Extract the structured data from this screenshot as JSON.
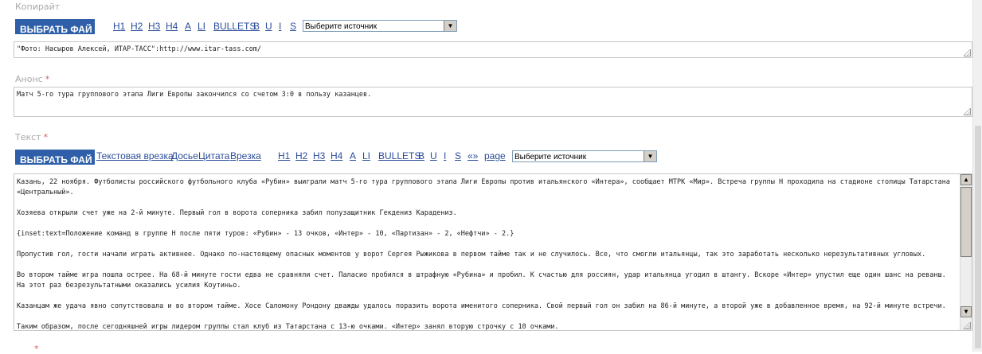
{
  "copyright": {
    "label": "Копирайт",
    "upload_label": "ВЫБРАТЬ ФАЙ",
    "toolbar": [
      "H1",
      "H2",
      "H3",
      "H4",
      "A",
      "LI",
      "BULLETS",
      "B",
      "U",
      "I",
      "S"
    ],
    "source_select": "Выберите источник",
    "value": "\"Фото: Насыров Алексей, ИТАР-ТАСС\":http://www.itar-tass.com/"
  },
  "announce": {
    "label": "Анонс",
    "required_mark": "*",
    "value": "Матч 5-го тура группового этапа Лиги Европы закончился со счетом 3:0 в пользу казанцев."
  },
  "text": {
    "label": "Текст",
    "required_mark": "*",
    "upload_label": "ВЫБРАТЬ ФАЙ",
    "insert_links": [
      "Текстовая врезка",
      "Досье",
      "Цитата",
      "Врезка"
    ],
    "toolbar": [
      "H1",
      "H2",
      "H3",
      "H4",
      "A",
      "LI",
      "BULLETS",
      "B",
      "U",
      "I",
      "S",
      "«»",
      "page"
    ],
    "source_select": "Выберите источник",
    "paragraphs": [
      "Казань, 22 ноября. Футболисты российского футбольного клуба «Рубин» выиграли матч 5-го тура группового этапа Лиги Европы против итальянского «Интера», сообщает МТРК «Мир». Встреча группы H проходила на стадионе столицы Татарстана «Центральный».",
      "Хозяева открыли счет уже на 2-й минуте. Первый гол в ворота соперника забил полузащитник Гекдениз Карадениз.",
      "{inset:text=Положение команд в группе H после пяти туров: «Рубин» - 13 очков, «Интер» - 10, «Партизан» - 2, «Нефтчи» - 2.}",
      "Пропустив гол, гости начали играть активнее. Однако по-настоящему опасных моментов у ворот Сергея Рыжикова в первом тайме так и не случилось. Все, что смогли итальянцы, так это заработать несколько нерезультативных угловых.",
      "Во втором тайме игра пошла острее. На 68-й минуте гости едва не сравняли счет. Паласио пробился в штрафную «Рубина» и пробил. К счастью для россиян, удар итальянца угодил в штангу. Вскоре «Интер» упустил еще один шанс на реванш. На этот раз безрезультатными оказались усилия Коутиньо.",
      "Казанцам же удача явно сопутствовала и во втором тайме. Хосе Саломону Рондону дважды удалось поразить ворота именитого соперника. Свой первый гол он забил на 86-й минуте, а второй уже в добавленное время, на 92-й минуте встречи.",
      "Таким образом, после сегодняшней игры лидером группы стал клуб из Татарстана с 13-ю очками. «Интер» занял вторую строчку с 10 очками."
    ]
  },
  "next_section": {
    "required_mark": "*"
  },
  "icons": {
    "dropdown": "chevron-down-icon",
    "scroll_up": "arrow-up-icon",
    "scroll_down": "arrow-down-icon",
    "resize": "resize-grip-icon"
  },
  "colors": {
    "upload_button": "#2e5fa8",
    "link": "#2a4d9a",
    "label": "#a8a8a8",
    "required": "#e05555"
  }
}
